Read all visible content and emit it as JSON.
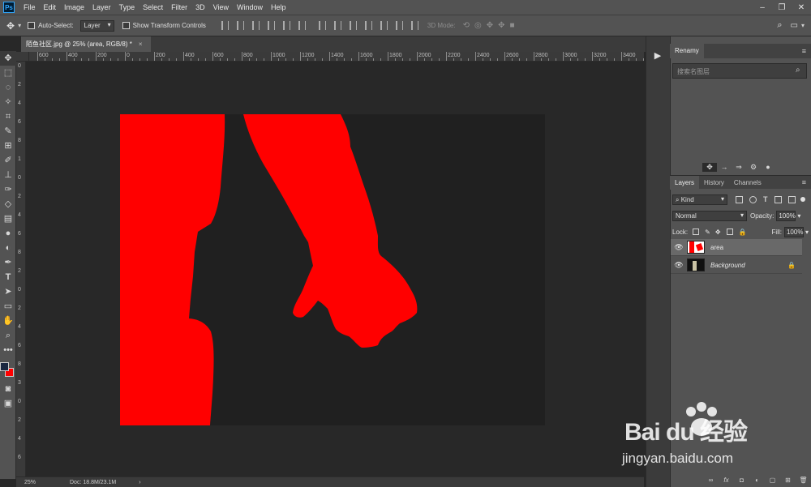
{
  "menubar": {
    "logo": "Ps",
    "items": [
      "File",
      "Edit",
      "Image",
      "Layer",
      "Type",
      "Select",
      "Filter",
      "3D",
      "View",
      "Window",
      "Help"
    ],
    "window_controls": [
      "–",
      "❐",
      "✕"
    ]
  },
  "options": {
    "auto_select_label": "Auto-Select:",
    "auto_select_value": "Layer",
    "show_transform_label": "Show Transform Controls",
    "mode_label": "3D Mode:"
  },
  "document": {
    "tab_title": "陌鱼社区.jpg @ 25% (area, RGB/8) *",
    "close": "×"
  },
  "ruler": {
    "h_labels": [
      "600",
      "400",
      "200",
      "0",
      "200",
      "400",
      "600",
      "800",
      "1000",
      "1200",
      "1400",
      "1600",
      "1800",
      "2000",
      "2200",
      "2400",
      "2600",
      "2800",
      "3000",
      "3200",
      "3400",
      "3600"
    ],
    "v_labels": [
      "0",
      "2",
      "4",
      "6",
      "8",
      "1",
      "0",
      "2",
      "4",
      "6",
      "8",
      "2",
      "0",
      "2",
      "4",
      "6",
      "8",
      "3",
      "0",
      "2",
      "4",
      "6"
    ]
  },
  "statusbar": {
    "zoom": "25%",
    "doc": "Doc: 18.8M/23.1M",
    "arrow": "›"
  },
  "right_panel": {
    "title": "Renamy",
    "search_placeholder": "搜索名图层",
    "icon_row": [
      "✥",
      "→",
      "⇒",
      "⚙",
      "●"
    ]
  },
  "layers_panel": {
    "tabs": [
      "Layers",
      "History",
      "Channels"
    ],
    "kind_label": "Kind",
    "blend_mode": "Normal",
    "opacity_label": "Opacity:",
    "opacity_value": "100%",
    "lock_label": "Lock:",
    "fill_label": "Fill:",
    "fill_value": "100%",
    "layers": [
      {
        "name": "area",
        "visible": true,
        "selected": true,
        "locked": false
      },
      {
        "name": "Background",
        "visible": true,
        "selected": false,
        "locked": true
      }
    ],
    "footer_icons": [
      "∞",
      "fx",
      "◘",
      "◐",
      "▢",
      "⊞",
      "🗑"
    ]
  },
  "watermark": {
    "brand": "Bai du 经验",
    "url": "jingyan.baidu.com"
  },
  "colors": {
    "foreground": "#1a2740",
    "background": "#ff0000",
    "shape": "#ff0000"
  }
}
